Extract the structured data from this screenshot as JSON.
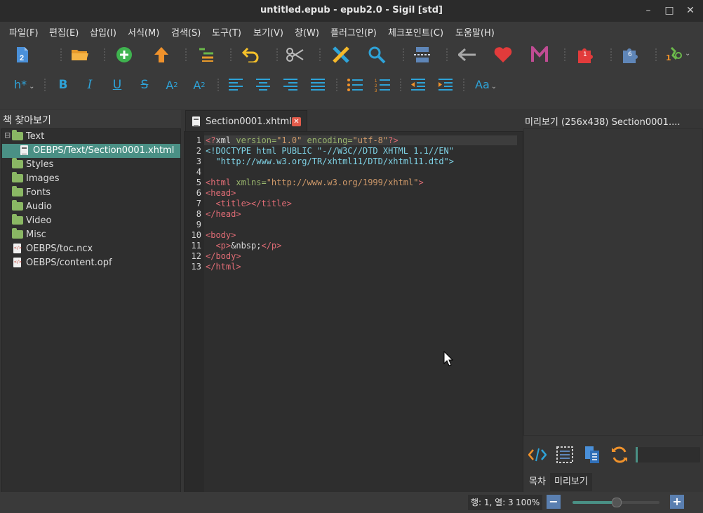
{
  "window": {
    "title": "untitled.epub - epub2.0 - Sigil [std]"
  },
  "menu": [
    "파일(F)",
    "편집(E)",
    "삽입(I)",
    "서식(M)",
    "검색(S)",
    "도구(T)",
    "보기(V)",
    "창(W)",
    "플러그인(P)",
    "체크포인트(C)",
    "도움말(H)"
  ],
  "toolbar": {
    "heading_label": "h*",
    "case_label": "Aa",
    "plugin_badges": [
      "1",
      "6",
      "1"
    ]
  },
  "book_browser": {
    "title": "책 찾아보기",
    "items": [
      {
        "label": "Text",
        "type": "folder",
        "expanded": true
      },
      {
        "label": "OEBPS/Text/Section0001.xhtml",
        "type": "xhtml",
        "selected": true
      },
      {
        "label": "Styles",
        "type": "folder"
      },
      {
        "label": "Images",
        "type": "folder"
      },
      {
        "label": "Fonts",
        "type": "folder"
      },
      {
        "label": "Audio",
        "type": "folder"
      },
      {
        "label": "Video",
        "type": "folder"
      },
      {
        "label": "Misc",
        "type": "folder"
      },
      {
        "label": "OEBPS/toc.ncx",
        "type": "code"
      },
      {
        "label": "OEBPS/content.opf",
        "type": "code"
      }
    ]
  },
  "editor": {
    "tab_label": "Section0001.xhtml",
    "lines": [
      [
        {
          "c": "t",
          "s": "<?"
        },
        {
          "c": "tx",
          "s": "xml"
        },
        {
          "c": "a",
          "s": " version="
        },
        {
          "c": "v",
          "s": "\"1.0\""
        },
        {
          "c": "a",
          "s": " encoding="
        },
        {
          "c": "v",
          "s": "\"utf-8\""
        },
        {
          "c": "t",
          "s": "?>"
        }
      ],
      [
        {
          "c": "dt",
          "s": "<!DOCTYPE html PUBLIC \"-//W3C//DTD XHTML 1.1//EN\""
        }
      ],
      [
        {
          "c": "dt",
          "s": "  \"http://www.w3.org/TR/xhtml11/DTD/xhtml11.dtd\">"
        }
      ],
      [],
      [
        {
          "c": "t",
          "s": "<html"
        },
        {
          "c": "a",
          "s": " xmlns="
        },
        {
          "c": "v",
          "s": "\"http://www.w3.org/1999/xhtml\""
        },
        {
          "c": "t",
          "s": ">"
        }
      ],
      [
        {
          "c": "t",
          "s": "<head>"
        }
      ],
      [
        {
          "c": "t",
          "s": "  <title></title>"
        }
      ],
      [
        {
          "c": "t",
          "s": "</head>"
        }
      ],
      [],
      [
        {
          "c": "t",
          "s": "<body>"
        }
      ],
      [
        {
          "c": "t",
          "s": "  <p>"
        },
        {
          "c": "tx",
          "s": "&nbsp;"
        },
        {
          "c": "t",
          "s": "</p>"
        }
      ],
      [
        {
          "c": "t",
          "s": "</body>"
        }
      ],
      [
        {
          "c": "t",
          "s": "</html>"
        }
      ]
    ]
  },
  "preview": {
    "title": "미리보기 (256x438) Section0001....",
    "tabs": [
      "목차",
      "미리보기"
    ]
  },
  "status": {
    "position": "행: 1, 열: 3",
    "zoom": "100%",
    "zoom_level": 0.5
  }
}
